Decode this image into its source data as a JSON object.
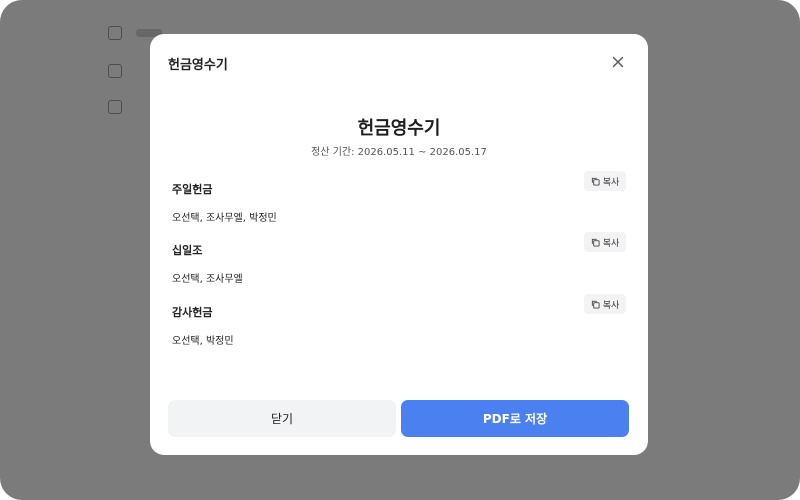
{
  "modal": {
    "header_title": "헌금영수기",
    "receipt_title": "헌금영수기",
    "period": "정산 기간: 2026.05.11 ~ 2026.05.17",
    "sections": [
      {
        "name": "주일헌금",
        "copy_label": "복사",
        "members": "오선택, 조사무엘, 박정민"
      },
      {
        "name": "십일조",
        "copy_label": "복사",
        "members": "오선택, 조사무엘"
      },
      {
        "name": "감사헌금",
        "copy_label": "복사",
        "members": "오선택, 박정민"
      }
    ],
    "close_label": "닫기",
    "save_pdf_label": "PDF로 저장"
  },
  "icons": {
    "close": "close-icon",
    "copy": "copy-icon"
  },
  "colors": {
    "primary": "#4a80f0",
    "secondary_button": "#f2f3f5",
    "overlay": "rgba(0,0,0,0.5)"
  }
}
